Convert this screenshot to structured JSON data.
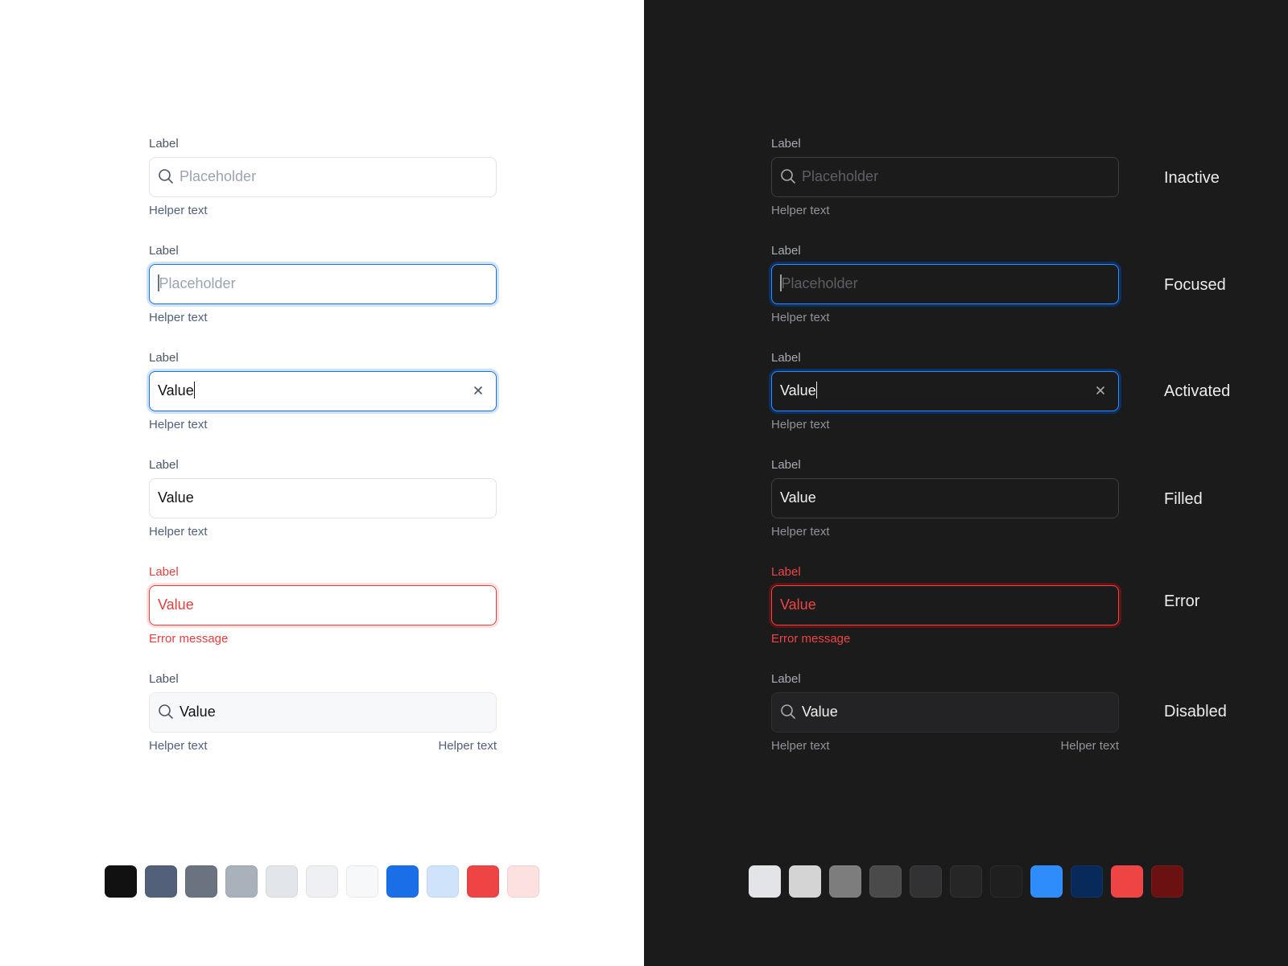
{
  "themes": {
    "light": {
      "background": "#ffffff",
      "fields": [
        {
          "state": "inactive",
          "label": "Label",
          "placeholder": "Placeholder",
          "icon": "search-icon",
          "helper": "Helper text"
        },
        {
          "state": "focused",
          "label": "Label",
          "placeholder": "Placeholder",
          "helper": "Helper text"
        },
        {
          "state": "activated",
          "label": "Label",
          "value": "Value",
          "clear_icon": "close-icon",
          "helper": "Helper text"
        },
        {
          "state": "filled",
          "label": "Label",
          "value": "Value",
          "helper": "Helper text"
        },
        {
          "state": "error",
          "label": "Label",
          "value": "Value",
          "helper": "Error message"
        },
        {
          "state": "disabled",
          "label": "Label",
          "value": "Value",
          "icon": "search-icon",
          "helper": "Helper text",
          "helper_right": "Helper text"
        }
      ],
      "swatches": [
        "#111111",
        "#52607a",
        "#6b7280",
        "#a9b1ba",
        "#e2e6ea",
        "#eef0f3",
        "#f7f8fa",
        "#1a6fe8",
        "#cfe4fb",
        "#ef4444",
        "#fde0e0"
      ]
    },
    "dark": {
      "background": "#1b1b1b",
      "fields": [
        {
          "state": "inactive",
          "label": "Label",
          "placeholder": "Placeholder",
          "icon": "search-icon",
          "helper": "Helper text"
        },
        {
          "state": "focused",
          "label": "Label",
          "placeholder": "Placeholder",
          "helper": "Helper text"
        },
        {
          "state": "activated",
          "label": "Label",
          "value": "Value",
          "clear_icon": "close-icon",
          "helper": "Helper text"
        },
        {
          "state": "filled",
          "label": "Label",
          "value": "Value",
          "helper": "Helper text"
        },
        {
          "state": "error",
          "label": "Label",
          "value": "Value",
          "helper": "Error message"
        },
        {
          "state": "disabled",
          "label": "Label",
          "value": "Value",
          "icon": "search-icon",
          "helper": "Helper text",
          "helper_right": "Helper text"
        }
      ],
      "swatches": [
        "#e2e4e8",
        "#d4d4d4",
        "#7d7d7d",
        "#4a4a4a",
        "#323235",
        "#262627",
        "#1f1f1f",
        "#2f8dfb",
        "#072a5a",
        "#ef4444",
        "#6b1111"
      ]
    }
  },
  "state_names": [
    "Inactive",
    "Focused",
    "Activated",
    "Filled",
    "Error",
    "Disabled"
  ]
}
